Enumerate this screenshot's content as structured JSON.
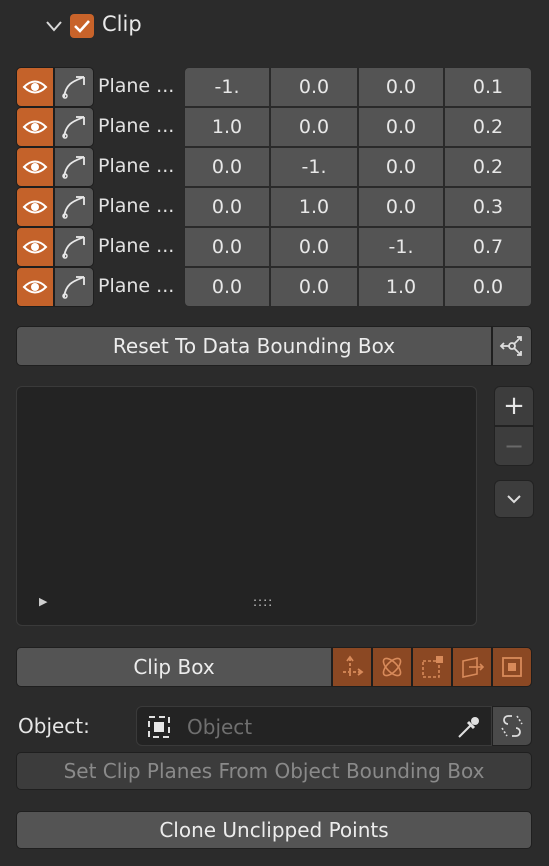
{
  "header": {
    "title": "Clip",
    "checked": true,
    "expanded": true
  },
  "planes": [
    {
      "label": "Plane ...",
      "values": [
        "-1.",
        "0.0",
        "0.0",
        "0.1"
      ]
    },
    {
      "label": "Plane ...",
      "values": [
        "1.0",
        "0.0",
        "0.0",
        "0.2"
      ]
    },
    {
      "label": "Plane ...",
      "values": [
        "0.0",
        "-1.",
        "0.0",
        "0.2"
      ]
    },
    {
      "label": "Plane ...",
      "values": [
        "0.0",
        "1.0",
        "0.0",
        "0.3"
      ]
    },
    {
      "label": "Plane ...",
      "values": [
        "0.0",
        "0.0",
        "-1.",
        "0.7"
      ]
    },
    {
      "label": "Plane ...",
      "values": [
        "0.0",
        "0.0",
        "1.0",
        "0.0"
      ]
    }
  ],
  "reset_button": {
    "label": "Reset To Data Bounding Box"
  },
  "list_panel": {
    "add_symbol": "+",
    "remove_symbol": "−",
    "expand_symbol": "▶",
    "grip_symbol": "::::"
  },
  "clip_box": {
    "label": "Clip Box"
  },
  "object": {
    "label": "Object:",
    "placeholder": "Object"
  },
  "set_planes_button": {
    "label": "Set Clip Planes From Object Bounding Box"
  },
  "clone_button": {
    "label": "Clone Unclipped Points"
  },
  "colors": {
    "accent": "#c4622a",
    "accent_dark": "#8b4823",
    "panel": "#2b2b2b",
    "field": "#545454"
  }
}
